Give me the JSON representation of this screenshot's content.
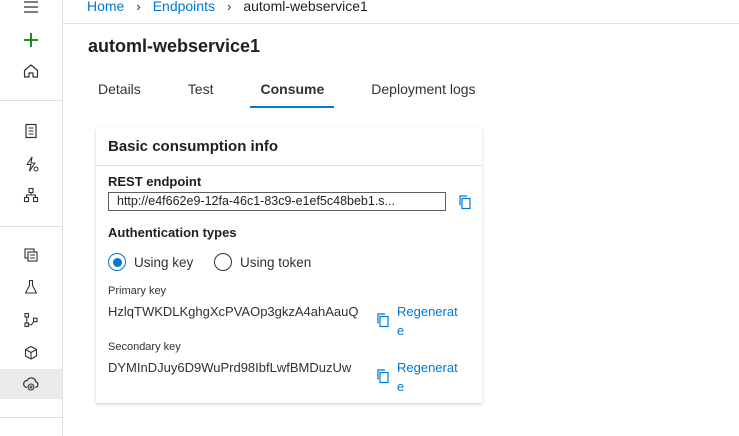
{
  "breadcrumb": {
    "home": "Home",
    "endpoints": "Endpoints",
    "current": "automl-webservice1"
  },
  "page": {
    "title": "automl-webservice1"
  },
  "tabs": [
    {
      "label": "Details"
    },
    {
      "label": "Test"
    },
    {
      "label": "Consume",
      "active": true
    },
    {
      "label": "Deployment logs"
    }
  ],
  "card": {
    "title": "Basic consumption info",
    "rest_label": "REST endpoint",
    "rest_value": "http://e4f662e9-12fa-46c1-83c9-e1ef5c48beb1.s...",
    "auth_label": "Authentication types",
    "auth_options": [
      {
        "label": "Using key",
        "checked": true
      },
      {
        "label": "Using token",
        "checked": false
      }
    ],
    "primary_label": "Primary key",
    "primary_value": "HzlqTWKDLKghgXcPVAOp3gkzA4ahAauQ",
    "secondary_label": "Secondary key",
    "secondary_value": "DYMInDJuy6D9WuPrd98IbfLwfBMDuzUw",
    "regenerate_label": "Regenerate"
  },
  "colors": {
    "accent": "#0078d4",
    "green": "#107c10",
    "rail_active": "#edebe9"
  },
  "rail_icons": [
    "hamburger-icon",
    "plus-icon",
    "home-icon",
    "notebook-icon",
    "automl-icon",
    "designer-icon",
    "datasets-icon",
    "experiments-icon",
    "pipelines-icon",
    "models-icon",
    "endpoints-icon"
  ]
}
